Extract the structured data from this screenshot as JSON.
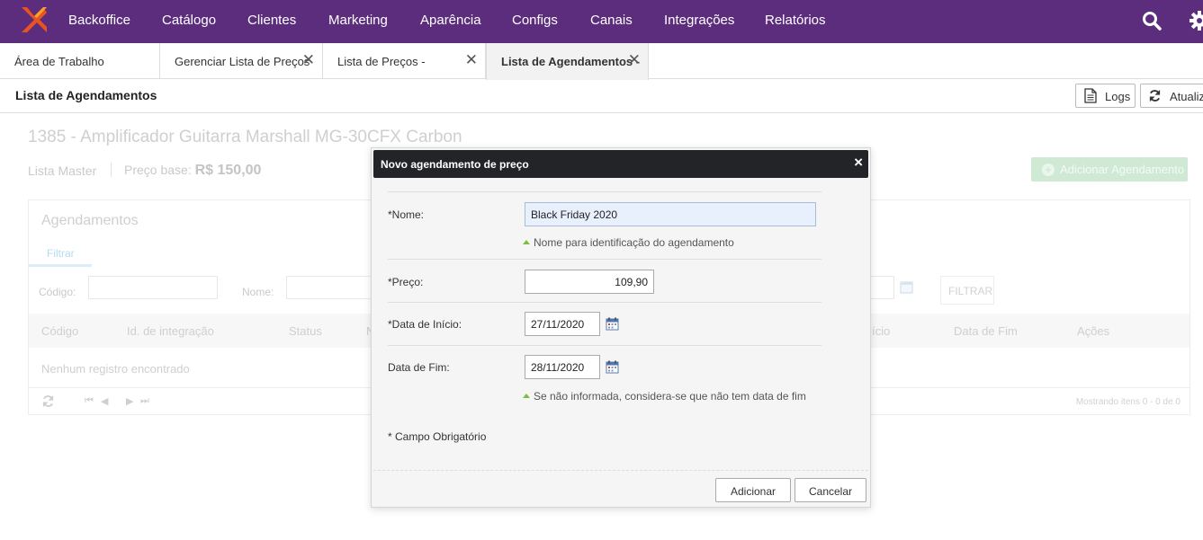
{
  "nav": {
    "items": [
      "Backoffice",
      "Catálogo",
      "Clientes",
      "Marketing",
      "Aparência",
      "Configs",
      "Canais",
      "Integrações",
      "Relatórios"
    ],
    "icons": [
      "search-icon",
      "gear-icon"
    ],
    "brand_color": "#5c2d7d",
    "logo_color": "#e8541f"
  },
  "tabs": [
    {
      "label": "Área de Trabalho",
      "closable": false
    },
    {
      "label": "Gerenciar Lista de Preços",
      "closable": true
    },
    {
      "label": "Lista de Preços -",
      "closable": true
    },
    {
      "label": "Lista de Agendamentos -",
      "closable": true,
      "active": true
    }
  ],
  "header": {
    "title": "Lista de Agendamentos",
    "logs_label": "Logs",
    "refresh_label": "Atualiz"
  },
  "product": {
    "title": "1385 - Amplificador Guitarra Marshall MG-30CFX Carbon",
    "list_name": "Lista Master",
    "base_price_label": "Preço base:",
    "base_price_value": "R$ 150,00",
    "add_button": "Adicionar Agendamento"
  },
  "panel": {
    "title": "Agendamentos",
    "filter_tab": "Filtrar",
    "filter_labels": {
      "code": "Código:",
      "name": "Nome:"
    },
    "filter_button": "FILTRAR",
    "columns": [
      "Código",
      "Id. de integração",
      "Status",
      "N",
      "ício",
      "Data de Fim",
      "Ações"
    ],
    "empty": "Nenhum registro encontrado",
    "showing": "Mostrando itens 0 - 0 de 0"
  },
  "modal": {
    "title": "Novo agendamento de preço",
    "close": "×",
    "fields": {
      "name": {
        "label": "*Nome:",
        "value": "Black Friday 2020",
        "hint": "Nome para identificação do agendamento"
      },
      "price": {
        "label": "*Preço:",
        "value": "109,90"
      },
      "start": {
        "label": "*Data de Início:",
        "value": "27/11/2020"
      },
      "end": {
        "label": "Data de Fim:",
        "value": "28/11/2020",
        "hint": "Se não informada, considera-se que não tem data de fim"
      }
    },
    "required_note": "* Campo Obrigatório",
    "add_button": "Adicionar",
    "cancel_button": "Cancelar"
  }
}
